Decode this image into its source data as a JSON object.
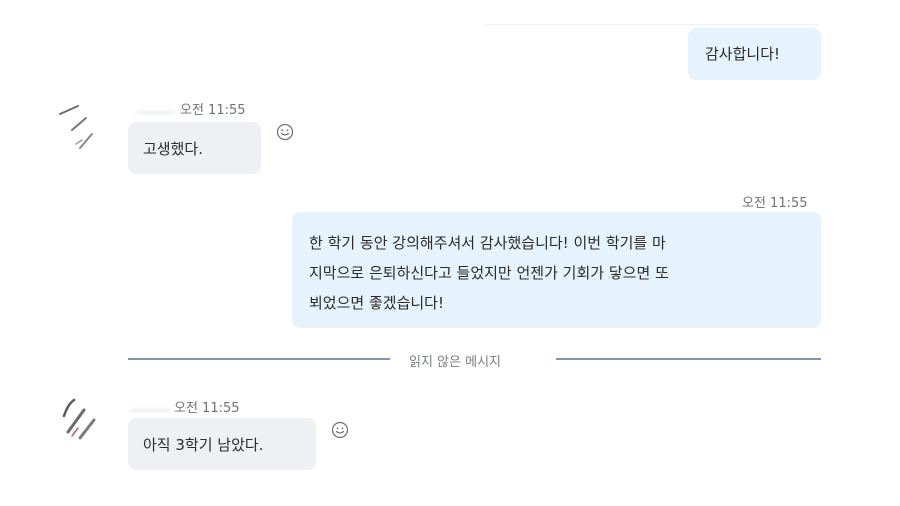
{
  "messages": [
    {
      "direction": "outgoing",
      "text": "감사합니다!"
    },
    {
      "direction": "incoming",
      "time": "오전 11:55",
      "text": "고생했다."
    },
    {
      "direction": "outgoing",
      "time": "오전 11:55",
      "lines": [
        "한 학기 동안 강의해주셔서 감사했습니다! 이번 학기를 마",
        "지막으로 은퇴하신다고 들었지만 언젠가 기회가 닿으면 또",
        "뵈었으면 좋겠습니다!"
      ]
    },
    {
      "direction": "incoming",
      "time": "오전 11:55",
      "text": "아직 3학기 남았다."
    }
  ],
  "unread_divider": {
    "label": "읽지 않은 메시지"
  },
  "icons": {
    "reaction": "smiley-icon",
    "avatar": "avatar-icon"
  },
  "colors": {
    "outgoing_bubble": "#e6f2fc",
    "incoming_bubble": "#eef0f4",
    "divider": "#7f95ab"
  }
}
